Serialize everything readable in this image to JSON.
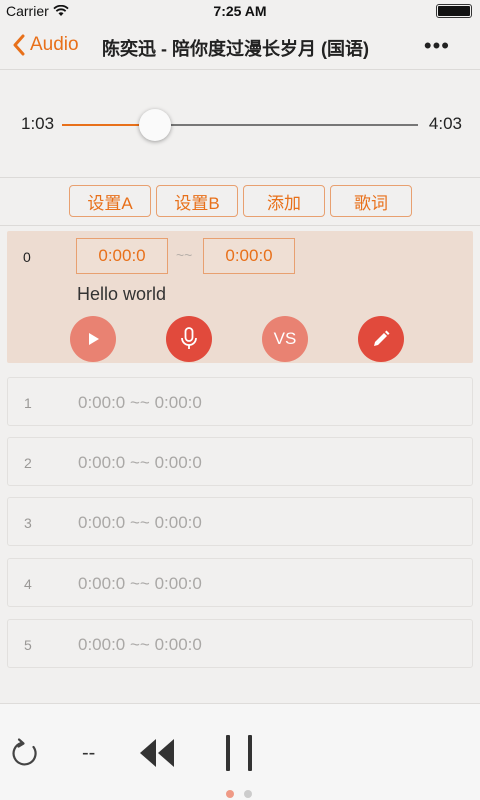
{
  "status": {
    "carrier": "Carrier",
    "time": "7:25 AM"
  },
  "nav": {
    "back_label": "Audio",
    "title": "陈奕迅 - 陪你度过漫长岁月 (国语)",
    "more": "•••"
  },
  "player": {
    "current_time": "1:03",
    "total_time": "4:03",
    "progress": 0.26
  },
  "actions": [
    "设置A",
    "设置B",
    "添加",
    "歌词"
  ],
  "active_segment": {
    "index": "0",
    "start": "0:00:0",
    "separator": "~~",
    "end": "0:00:0",
    "text": "Hello world",
    "buttons": [
      {
        "icon": "play-icon",
        "color": "#e98272",
        "label": ""
      },
      {
        "icon": "microphone-icon",
        "color": "#e14a3c",
        "label": ""
      },
      {
        "icon": "vs-icon",
        "color": "#e98272",
        "label": "VS"
      },
      {
        "icon": "pencil-icon",
        "color": "#e14a3c",
        "label": ""
      }
    ]
  },
  "segments": [
    {
      "index": "1",
      "range": "0:00:0 ~~ 0:00:0"
    },
    {
      "index": "2",
      "range": "0:00:0 ~~ 0:00:0"
    },
    {
      "index": "3",
      "range": "0:00:0 ~~ 0:00:0"
    },
    {
      "index": "4",
      "range": "0:00:0 ~~ 0:00:0"
    },
    {
      "index": "5",
      "range": "0:00:0 ~~ 0:00:0"
    }
  ],
  "bottom": {
    "repeat_status": "--",
    "page_count": 2,
    "active_page": 0
  },
  "colors": {
    "accent": "#e8701a",
    "red": "#e14a3c",
    "salmon": "#e98272",
    "active_bg": "#eddcd1"
  }
}
